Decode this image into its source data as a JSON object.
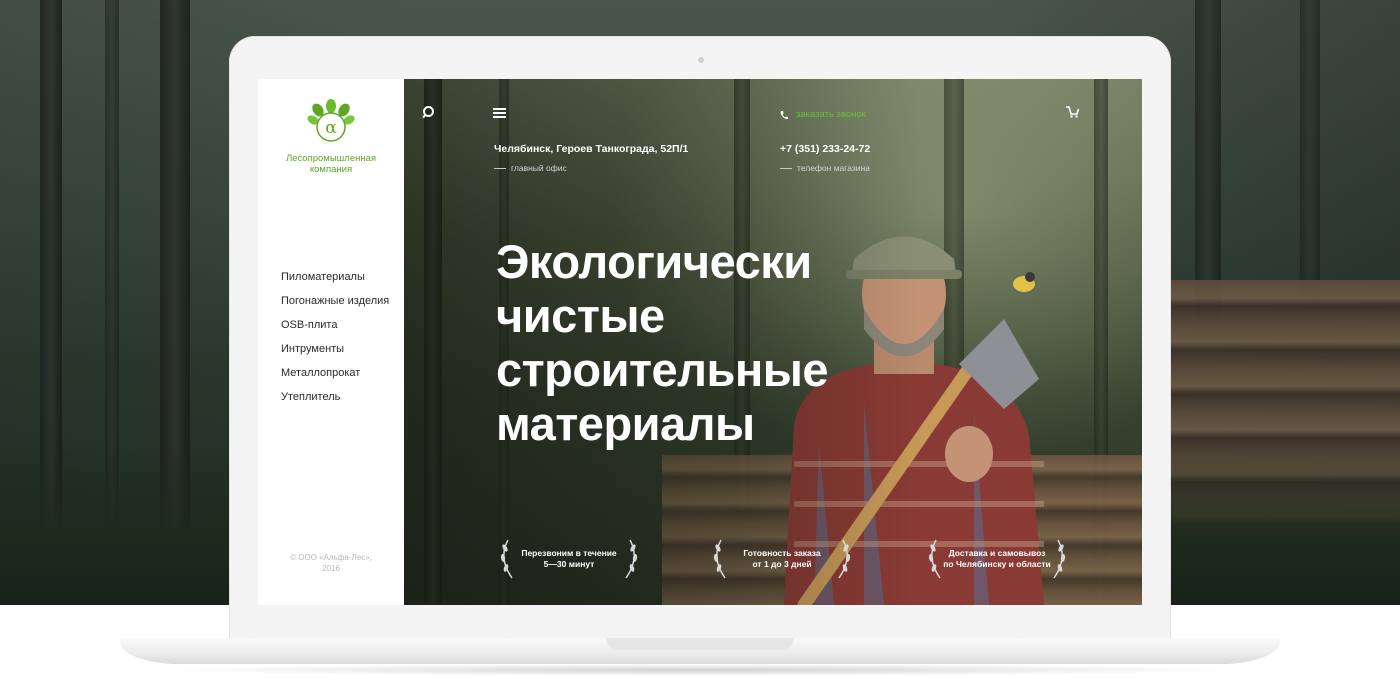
{
  "sidebar": {
    "company_line1": "Лесопромышленная",
    "company_line2": "компания",
    "nav": [
      {
        "label": "Пиломатериалы"
      },
      {
        "label": "Погонажные изделия"
      },
      {
        "label": "OSB-плита"
      },
      {
        "label": "Интрументы"
      },
      {
        "label": "Металлопрокат"
      },
      {
        "label": "Утеплитель"
      }
    ],
    "copyright_line1": "© ООО «Альфа-Лес»,",
    "copyright_line2": "2016"
  },
  "header": {
    "address": "Челябинск, Героев Танкограда, 52П/1",
    "address_caption": "главный офис",
    "callback_label": "заказать звонок",
    "phone": "+7 (351) 233-24-72",
    "phone_caption": "телефон магазина",
    "icons": [
      "search-icon",
      "menu-icon",
      "phone-icon",
      "cart-icon"
    ]
  },
  "hero": {
    "headline": [
      "Экологически",
      "чистые",
      "строительные",
      "материалы"
    ]
  },
  "features": [
    {
      "line1": "Перезвоним в течение",
      "line2": "5—30 минут"
    },
    {
      "line1": "Готовность заказа",
      "line2": "от  1 до 3  дней"
    },
    {
      "line1": "Доставка и самовывоз",
      "line2": "по Челябинску и области"
    }
  ],
  "colors": {
    "accent": "#5ea624",
    "callback": "#6cc034"
  }
}
